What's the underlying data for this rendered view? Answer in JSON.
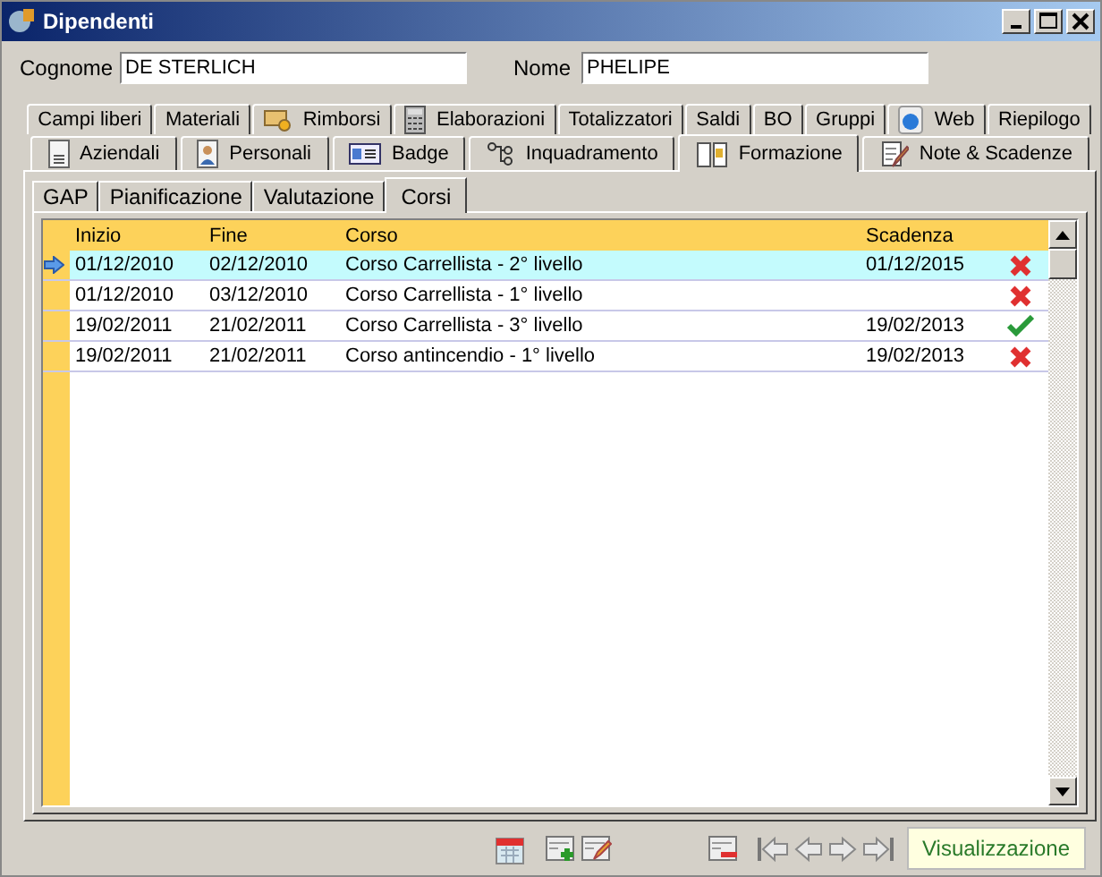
{
  "window": {
    "title": "Dipendenti"
  },
  "fields": [
    {
      "label": "Cognome",
      "value": "DE STERLICH"
    },
    {
      "label": "Nome",
      "value": "PHELIPE"
    }
  ],
  "tab_rows": [
    [
      {
        "label": "Campi liberi",
        "selected": false
      },
      {
        "label": "Materiali",
        "selected": false
      },
      {
        "label": "Rimborsi",
        "selected": false
      },
      {
        "label": "Elaborazioni",
        "selected": false
      },
      {
        "label": "Totalizzatori",
        "selected": false
      },
      {
        "label": "Saldi",
        "selected": false
      },
      {
        "label": "BO",
        "selected": false
      },
      {
        "label": "Gruppi",
        "selected": false
      },
      {
        "label": "Web",
        "selected": false
      },
      {
        "label": "Riepilogo",
        "selected": false
      }
    ],
    [
      {
        "label": "Aziendali",
        "selected": false
      },
      {
        "label": "Personali",
        "selected": false
      },
      {
        "label": "Badge",
        "selected": false
      },
      {
        "label": "Inquadramento",
        "selected": false
      },
      {
        "label": "Formazione",
        "selected": true
      },
      {
        "label": "Note & Scadenze",
        "selected": false
      }
    ]
  ],
  "subtabs": [
    {
      "label": "GAP",
      "selected": false
    },
    {
      "label": "Pianificazione",
      "selected": false
    },
    {
      "label": "Valutazione",
      "selected": false
    },
    {
      "label": "Corsi",
      "selected": true
    }
  ],
  "table": {
    "columns": [
      "Inizio",
      "Fine",
      "Corso",
      "Scadenza"
    ],
    "rows": [
      {
        "cells": [
          "01/12/2010",
          "02/12/2010",
          "Corso Carrellista - 2° livello",
          "01/12/2015"
        ],
        "selected": true,
        "passed": false
      },
      {
        "cells": [
          "01/12/2010",
          "03/12/2010",
          "Corso Carrellista - 1° livello",
          ""
        ],
        "selected": false,
        "passed": false
      },
      {
        "cells": [
          "19/02/2011",
          "21/02/2011",
          "Corso Carrellista - 3° livello",
          "19/02/2013"
        ],
        "selected": false,
        "passed": true
      },
      {
        "cells": [
          "19/02/2011",
          "21/02/2011",
          "Corso antincendio - 1° livello",
          "19/02/2013"
        ],
        "selected": false,
        "passed": false
      }
    ]
  },
  "status": "Visualizzazione"
}
